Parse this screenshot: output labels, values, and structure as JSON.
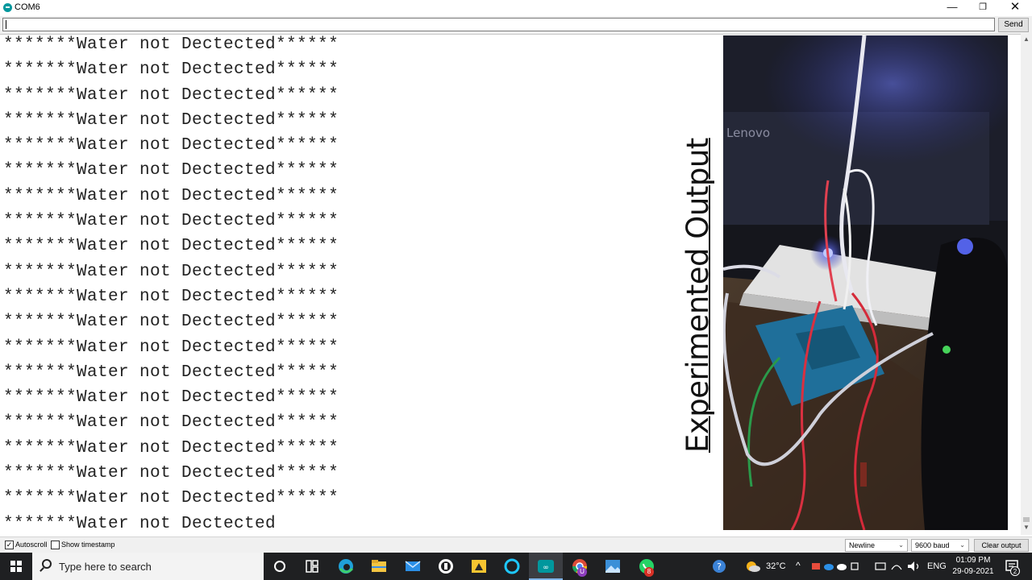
{
  "window": {
    "title": "COM6",
    "minimize_glyph": "—",
    "maximize_glyph": "❐",
    "close_glyph": "✕"
  },
  "send_bar": {
    "input_value": "",
    "send_label": "Send"
  },
  "output": {
    "lines": [
      "*******Water not Dectected******",
      "*******Water not Dectected******",
      "*******Water not Dectected******",
      "*******Water not Dectected******",
      "*******Water not Dectected******",
      "*******Water not Dectected******",
      "*******Water not Dectected******",
      "*******Water not Dectected******",
      "*******Water not Dectected******",
      "*******Water not Dectected******",
      "*******Water not Dectected******",
      "*******Water not Dectected******",
      "*******Water not Dectected******",
      "*******Water not Dectected******",
      "*******Water not Dectected******",
      "*******Water not Dectected******",
      "*******Water not Dectected******",
      "*******Water not Dectected******",
      "*******Water not Dectected******",
      "*******Water not Dectected"
    ]
  },
  "overlay": {
    "caption": "Experimented Output",
    "photo_brand_text": "Lenovo"
  },
  "footer": {
    "autoscroll_label": "Autoscroll",
    "autoscroll_checked": true,
    "timestamp_label": "Show timestamp",
    "timestamp_checked": false,
    "line_ending": "Newline",
    "baud_rate": "9600 baud",
    "clear_label": "Clear output"
  },
  "taskbar": {
    "search_placeholder": "Type here to search",
    "apps": [
      "cortana-icon",
      "task-view-icon",
      "edge-icon",
      "file-explorer-icon",
      "mail-icon",
      "app-circle-icon",
      "sticky-notes-icon",
      "alexa-icon",
      "arduino-icon",
      "chrome-icon",
      "photos-icon",
      "whatsapp-icon"
    ],
    "chrome_badge": "U",
    "whatsapp_badge": "8",
    "weather_temp": "32°C",
    "language": "ENG",
    "time": "01:09 PM",
    "date": "29-09-2021",
    "notification_count": "2",
    "colors": {
      "taskbar_bg": "#1f2022",
      "accent": "#00979d"
    }
  }
}
